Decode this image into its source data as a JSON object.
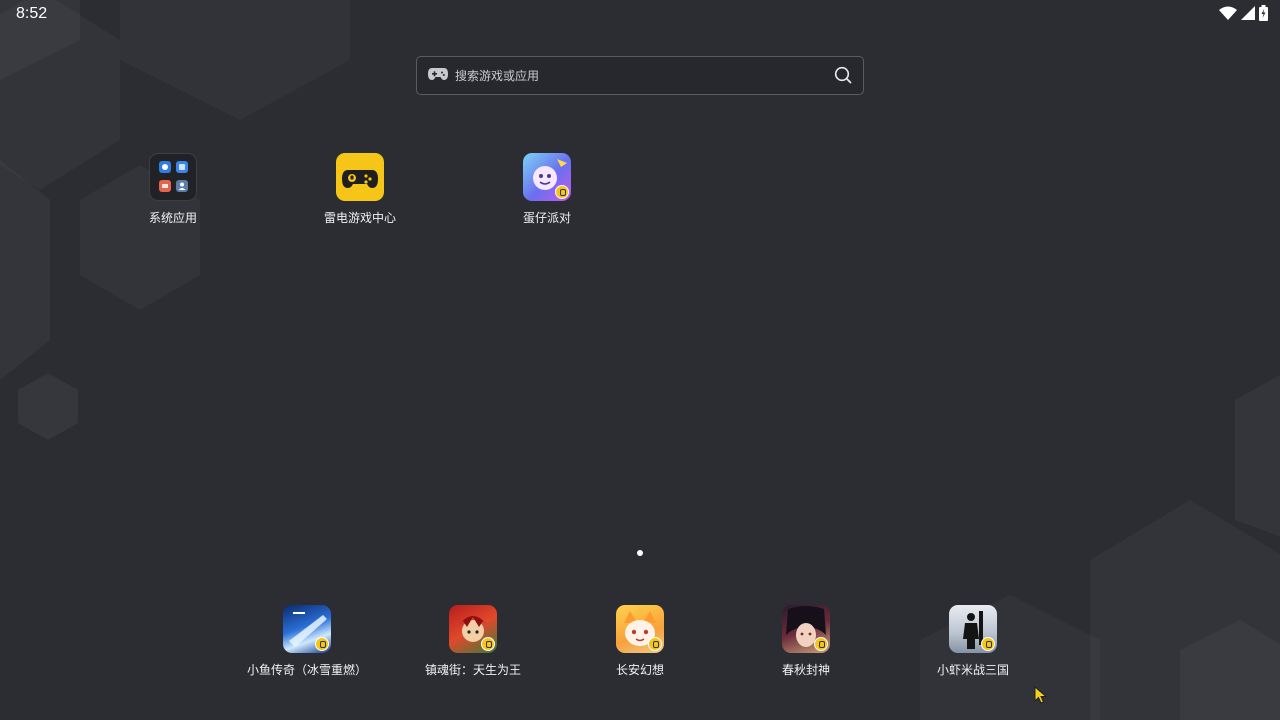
{
  "status": {
    "time": "8:52",
    "icons": [
      "wifi-icon",
      "signal-icon",
      "battery-icon"
    ]
  },
  "search": {
    "placeholder": "搜索游戏或应用",
    "left_icon": "gamepad-icon",
    "right_icon": "search-icon"
  },
  "apps": [
    {
      "label": "系统应用",
      "icon": "system-apps-folder-icon"
    },
    {
      "label": "雷电游戏中心",
      "icon": "ldplayer-game-center-icon"
    },
    {
      "label": "蛋仔派对",
      "icon": "eggy-party-icon"
    }
  ],
  "pager": {
    "current": 1,
    "total": 1
  },
  "dock": [
    {
      "label": "小鱼传奇（冰雪重燃）",
      "icon": "fish-legend-icon"
    },
    {
      "label": "镇魂街：天生为王",
      "icon": "zhenhunjie-icon"
    },
    {
      "label": "长安幻想",
      "icon": "changan-fantasy-icon"
    },
    {
      "label": "春秋封神",
      "icon": "chunqiu-fengshen-icon"
    },
    {
      "label": "小虾米战三国",
      "icon": "xiaoxiami-sanguo-icon"
    }
  ],
  "colors": {
    "background": "#2b2d33",
    "accent_yellow": "#f5c518"
  }
}
